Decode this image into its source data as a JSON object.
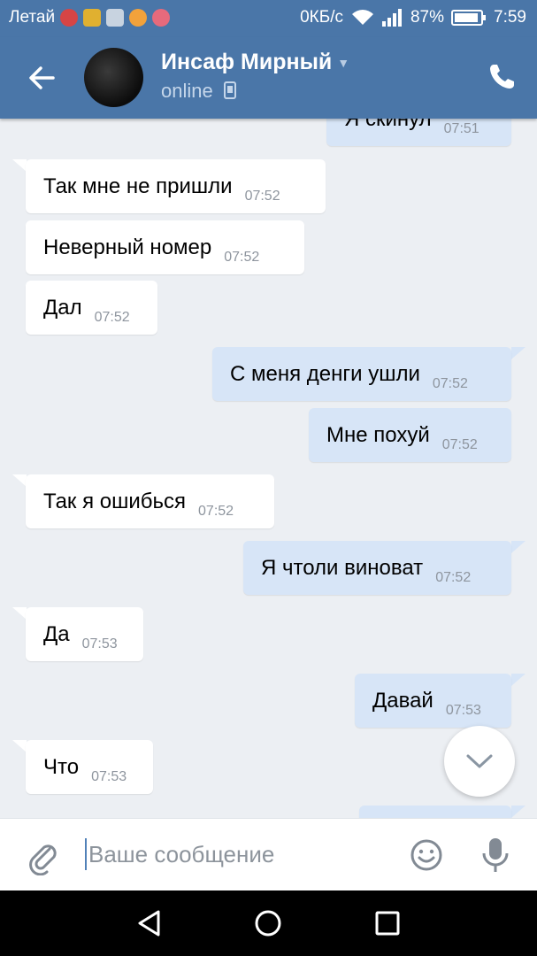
{
  "status_bar": {
    "carrier": "Летай",
    "network_speed": "0КБ/с",
    "battery": "87%",
    "time": "7:59"
  },
  "header": {
    "contact_name": "Инсаф Мирный",
    "status": "online"
  },
  "messages": [
    {
      "direction": "out",
      "text": "Я скинул",
      "time": "07:51"
    },
    {
      "direction": "in",
      "text": "Так мне не пришли",
      "time": "07:52"
    },
    {
      "direction": "in",
      "text": "Неверный номер",
      "time": "07:52"
    },
    {
      "direction": "in",
      "text": "Дал",
      "time": "07:52"
    },
    {
      "direction": "out",
      "text": "С меня денги ушли",
      "time": "07:52"
    },
    {
      "direction": "out",
      "text": "Мне похуй",
      "time": "07:52"
    },
    {
      "direction": "in",
      "text": "Так я ошибься",
      "time": "07:52"
    },
    {
      "direction": "out",
      "text": "Я чтоли виноват",
      "time": "07:52"
    },
    {
      "direction": "in",
      "text": "Да",
      "time": "07:53"
    },
    {
      "direction": "out",
      "text": "Давай",
      "time": "07:53"
    },
    {
      "direction": "in",
      "text": "Что",
      "time": "07:53"
    }
  ],
  "composer": {
    "placeholder": "Ваше сообщение"
  },
  "colors": {
    "header": "#4a76a8",
    "incoming_bubble": "#ffffff",
    "outgoing_bubble": "#d7e5f7",
    "chat_background": "#eceff3"
  }
}
